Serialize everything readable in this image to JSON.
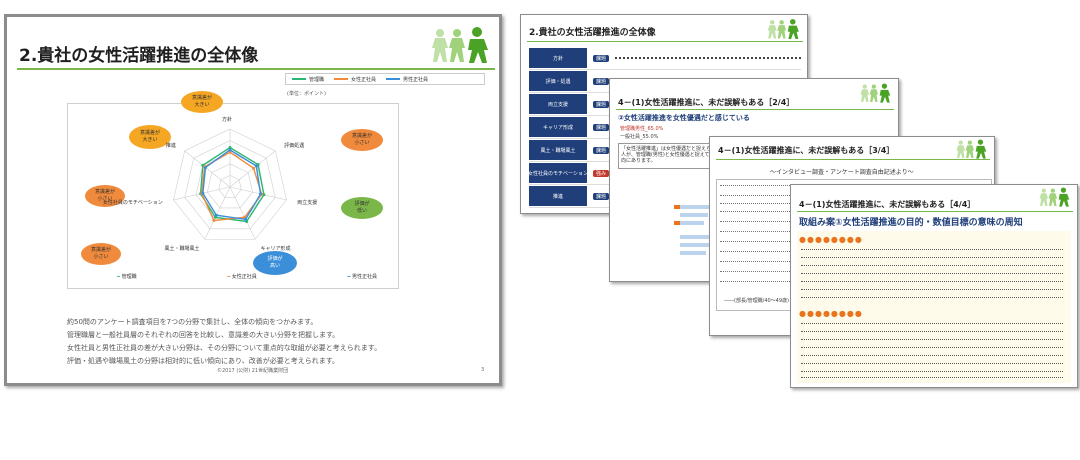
{
  "slide1": {
    "title": "2.貴社の女性活躍推進の全体像",
    "legend": [
      {
        "label": "管理職",
        "color": "#2bb673"
      },
      {
        "label": "女性正社員",
        "color": "#f08a3c"
      },
      {
        "label": "男性正社員",
        "color": "#3b8fd9"
      }
    ],
    "legend_note": "(単位：ポイント)",
    "axes": [
      "方針",
      "評価処遇",
      "両立支援",
      "キャリア形成",
      "風土・職場風土",
      "女性社員のモチベーション",
      "推進"
    ],
    "bubbles": [
      {
        "text": "意識差が\n大きい",
        "color": "#f5a623"
      },
      {
        "text": "意識差が\n大きい",
        "color": "#f5a623"
      },
      {
        "text": "意識差が\n小さい",
        "color": "#f08a3c"
      },
      {
        "text": "意識差が\n小さい",
        "color": "#f08a3c"
      },
      {
        "text": "意識差が\n小さい",
        "color": "#f08a3c"
      },
      {
        "text": "評価が\n低い",
        "color": "#7ab648"
      },
      {
        "text": "評価が\n高い",
        "color": "#3b8fd9"
      }
    ],
    "body_lines": [
      "約50問のアンケート調査項目を7つの分野で集計し、全体の傾向をつかみます。",
      "管理職層と一般社員層のそれぞれの回答を比較し、意識差の大きい分野を把握します。",
      "女性社員と男性正社員の差が大きい分野は、その分野について重点的な取組が必要と考えられます。",
      "評価・処遇や職場風土の分野は相対的に低い傾向にあり、改善が必要と考えられます。"
    ],
    "footer": "©2017 (公財) 21世紀職業財団",
    "page": "3"
  },
  "chart_data": {
    "type": "radar",
    "categories": [
      "方針",
      "評価処遇",
      "両立支援",
      "キャリア形成",
      "風土・職場風土",
      "女性社員のモチベーション",
      "推進"
    ],
    "series": [
      {
        "name": "管理職",
        "values": [
          3.4,
          3.1,
          3.0,
          3.3,
          2.9,
          2.6,
          3.0
        ]
      },
      {
        "name": "女性正社員",
        "values": [
          3.0,
          2.6,
          2.8,
          2.9,
          3.2,
          2.5,
          2.8
        ]
      },
      {
        "name": "男性正社員",
        "values": [
          3.2,
          2.9,
          2.7,
          3.1,
          2.7,
          2.4,
          2.7
        ]
      }
    ],
    "range": [
      0,
      5
    ],
    "legend_position": "top-right"
  },
  "slide2": {
    "title": "2.貴社の女性活躍推進の全体像",
    "rows": [
      "方針",
      "評価・処遇",
      "両立支援",
      "キャリア形成",
      "風土・職場風土",
      "女性社員のモチベーション",
      "推進"
    ],
    "badges": [
      "課題",
      "課題",
      "課題",
      "課題",
      "課題",
      "強み",
      "課題"
    ]
  },
  "slide3": {
    "title": "4－(1)女性活躍推進に、未だ誤解もある［2/4］",
    "subtitle": "②女性活躍推進を女性優遇だと感じている",
    "text": "「女性活躍推進」は女性優遇だと捉えられる人が、管理職(男性)と女性優遇と捉えている傾向にあります。",
    "stat1": "管理職男性_65.0%",
    "stat2": "一般社員_55.0%"
  },
  "slide4": {
    "title": "4－(1)女性活躍推進に、未だ誤解もある［3/4］",
    "subtitle": "～インタビュー調査・アンケート調査自由記述より～",
    "caption": "――(部長/管理職/40～49歳)"
  },
  "slide5": {
    "title": "4－(1)女性活躍推進に、未だ誤解もある［4/4］",
    "heading": "取組み案①女性活躍推進の目的・数値目標の意味の周知",
    "marker": "●●●●●●●●"
  },
  "colors": {
    "green": "#7ab648",
    "orange": "#e8741e",
    "red": "#c0392b",
    "navy": "#1f3e7a"
  }
}
